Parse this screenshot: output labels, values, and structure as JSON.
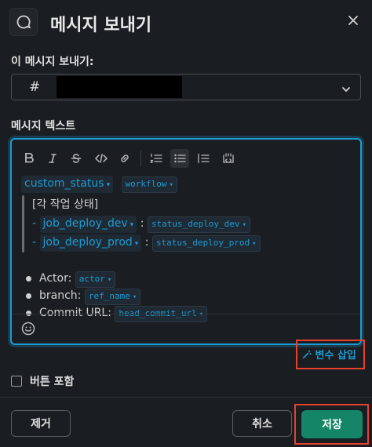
{
  "header": {
    "title": "메시지 보내기",
    "icon": "speech-bubble-icon",
    "close_icon": "close-icon"
  },
  "channel": {
    "label": "이 메시지 보내기:",
    "prefix": "#"
  },
  "message": {
    "label": "메시지 텍스트",
    "toolbar": [
      "bold",
      "italic",
      "strikethrough",
      "code",
      "link",
      "ordered-list",
      "bulleted-list",
      "blockquote",
      "code-block"
    ],
    "line1": {
      "var1": "custom_status",
      "var2": "workflow"
    },
    "quote_title": "[각 작업 상태]",
    "quote_items": [
      {
        "dash": "-",
        "var": "job_deploy_dev",
        "colon": ":",
        "status": "status_deploy_dev"
      },
      {
        "dash": "-",
        "var": "job_deploy_prod",
        "colon": ":",
        "status": "status_deploy_prod"
      }
    ],
    "bullets": [
      {
        "label": "Actor:",
        "token": "actor"
      },
      {
        "label": "branch:",
        "token": "ref_name"
      },
      {
        "label": "Commit URL:",
        "token": "head_commit_url"
      }
    ],
    "emoji_icon": "smiley-icon"
  },
  "insert_variable": {
    "label": "변수 삽입",
    "icon": "magic-wand-icon"
  },
  "include_button": {
    "label": "버튼 포함",
    "checked": false
  },
  "footer": {
    "remove": "제거",
    "cancel": "취소",
    "save": "저장"
  },
  "colors": {
    "accent": "#1d9bd1",
    "save": "#148567",
    "highlight": "#e8412c",
    "background": "#1a1d21"
  }
}
